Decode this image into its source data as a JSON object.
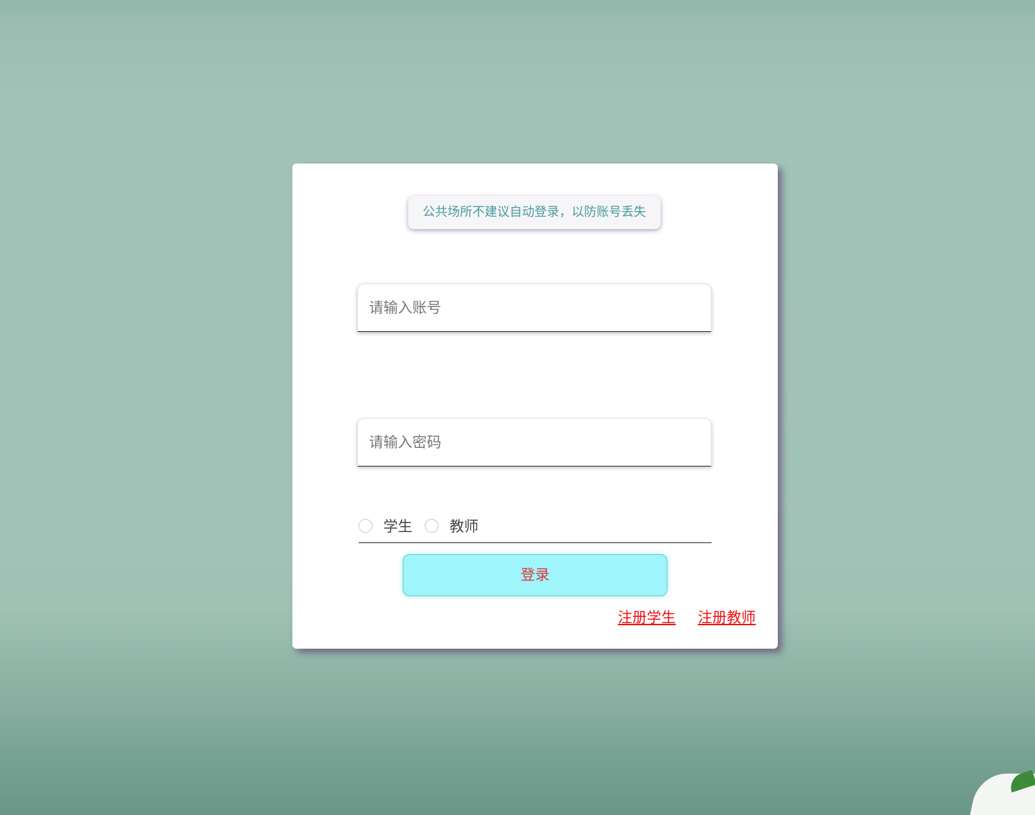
{
  "login": {
    "notice": "公共场所不建议自动登录，以防账号丢失",
    "account_placeholder": "请输入账号",
    "password_placeholder": "请输入密码",
    "roles": [
      "学生",
      "教师"
    ],
    "login_button": "登录",
    "register_student": "注册学生",
    "register_teacher": "注册教师"
  },
  "colors": {
    "notice_text": "#4a9aa0",
    "login_button_bg": "#9ff5fb",
    "login_button_text": "#e03838",
    "link": "#ee1111"
  }
}
